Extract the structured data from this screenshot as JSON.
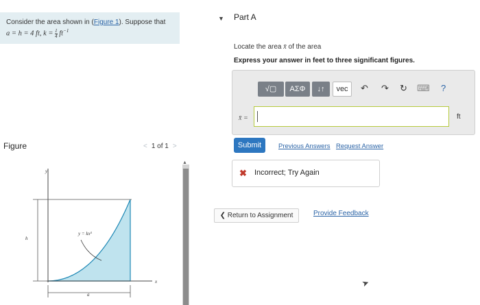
{
  "problem": {
    "text_before_link": "Consider the area shown in (",
    "link": "Figure 1",
    "text_after_link": "). Suppose that",
    "params_left": "a = h = 4 ft, k = ",
    "frac_num": "1",
    "frac_den": "4",
    "params_right": " ft",
    "exponent": "−1"
  },
  "figure_panel": {
    "label": "Figure",
    "pager_prev": "<",
    "pager_text": "1 of 1",
    "pager_next": ">",
    "caret": "▲",
    "diagram": {
      "y_axis": "y",
      "x_axis": "x",
      "height": "h",
      "width": "a",
      "curve_label": "y = kx³",
      "fill_color": "#bfe3ee"
    }
  },
  "part": {
    "toggle": "▼",
    "title": "Part A",
    "instruction_pre": "Locate the area ",
    "instruction_var": "x̄",
    "instruction_post": " of the area",
    "express": "Express your answer in feet to three significant figures."
  },
  "editor": {
    "tool_templates": "√▢",
    "tool_symbols": "ΑΣΦ",
    "tool_arrows": "↓↑",
    "tool_vec": "vec",
    "undo_icon": "↶",
    "redo_icon": "↷",
    "reset_icon": "↻",
    "keyboard_icon": "⌨",
    "help_icon": "?",
    "var_label": "x̄ =",
    "input_value": "",
    "unit": "ft"
  },
  "actions": {
    "submit": "Submit",
    "previous_answers": "Previous Answers",
    "request_answer": "Request Answer"
  },
  "feedback": {
    "icon": "✖",
    "text": "Incorrect; Try Again"
  },
  "footer": {
    "return": "❮ Return to Assignment",
    "provide_feedback": "Provide Feedback"
  },
  "colors": {
    "link": "#2a63a6",
    "submit": "#2d77c0",
    "problem_bg": "#e3eef2",
    "error": "#c0392b"
  }
}
